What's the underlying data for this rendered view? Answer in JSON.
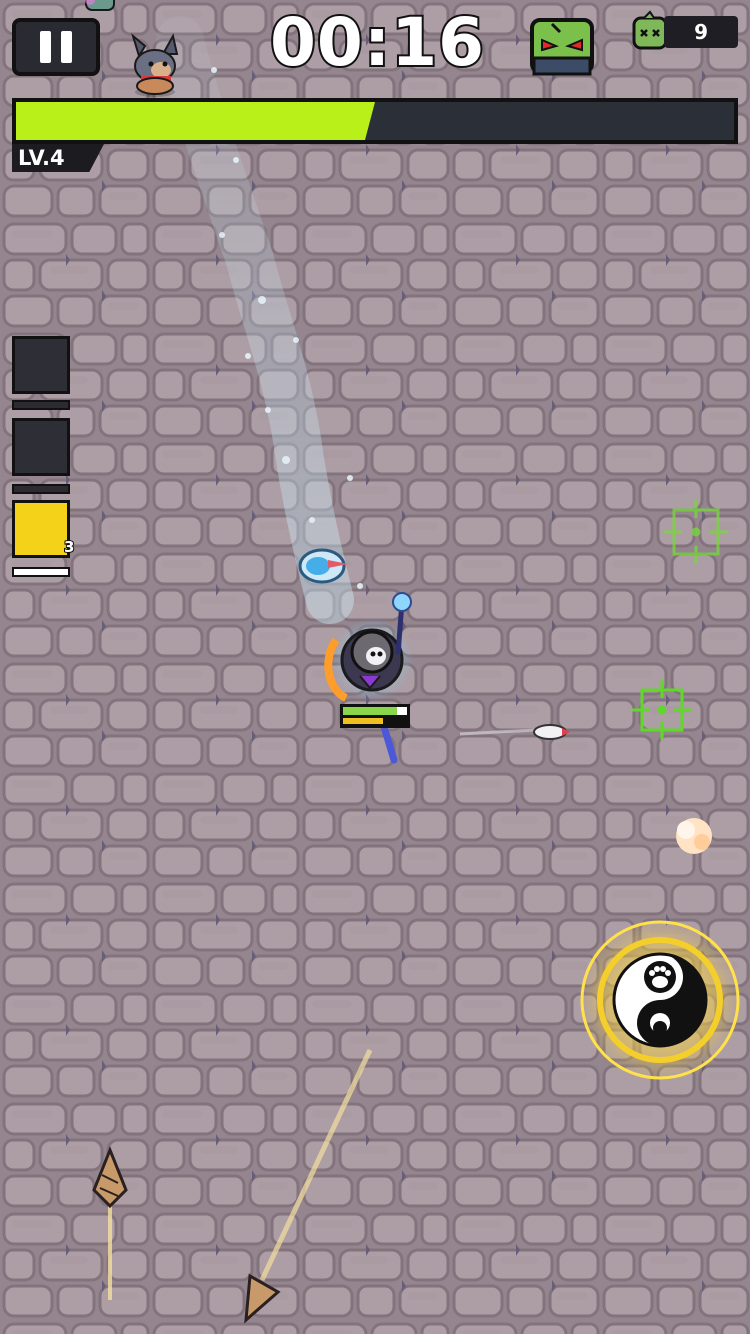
{
  "hud": {
    "timer": "00:16",
    "kill_count": "9",
    "level_label": "LV.4",
    "xp_progress": 0.5
  },
  "skills": [
    {
      "icon": "burst-icon",
      "cooldown": 0
    },
    {
      "icon": "shield-icon",
      "cooldown": 0
    },
    {
      "icon": "cannon-icon",
      "count": "3",
      "cooldown": 1
    }
  ],
  "colors": {
    "xp_fill": "#b9f01a",
    "xp_track": "#2b3038",
    "ground": "#8f7f88",
    "hud_dark": "#1e1e24"
  }
}
